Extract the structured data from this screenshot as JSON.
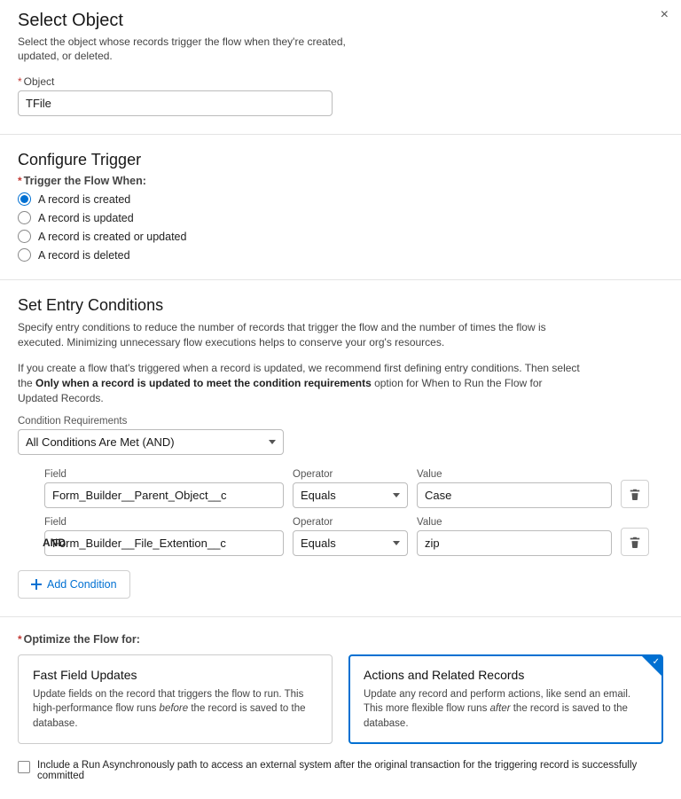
{
  "close_label": "×",
  "select_object": {
    "title": "Select Object",
    "desc": "Select the object whose records trigger the flow when they're created, updated, or deleted.",
    "object_label": "Object",
    "object_value": "TFile"
  },
  "configure_trigger": {
    "title": "Configure Trigger",
    "when_label": "Trigger the Flow When:",
    "options": {
      "created": "A record is created",
      "updated": "A record is updated",
      "created_or_updated": "A record is created or updated",
      "deleted": "A record is deleted"
    }
  },
  "entry_conditions": {
    "title": "Set Entry Conditions",
    "desc1": "Specify entry conditions to reduce the number of records that trigger the flow and the number of times the flow is executed. Minimizing unnecessary flow executions helps to conserve your org's resources.",
    "desc2_a": "If you create a flow that's triggered when a record is updated, we recommend first defining entry conditions. Then select the ",
    "desc2_bold": "Only when a record is updated to meet the condition requirements",
    "desc2_b": " option for When to Run the Flow for Updated Records.",
    "req_label": "Condition Requirements",
    "req_value": "All Conditions Are Met (AND)",
    "field_label": "Field",
    "operator_label": "Operator",
    "value_label": "Value",
    "and_label": "AND",
    "rows": [
      {
        "field": "Form_Builder__Parent_Object__c",
        "operator": "Equals",
        "value": "Case"
      },
      {
        "field": "Form_Builder__File_Extention__c",
        "operator": "Equals",
        "value": "zip"
      }
    ],
    "add_condition": "Add Condition"
  },
  "optimize": {
    "label": "Optimize the Flow for:",
    "card1_title": "Fast Field Updates",
    "card1_p1": "Update fields on the record that triggers the flow to run. This high-performance flow runs ",
    "card1_it": "before",
    "card1_p2": " the record is saved to the database.",
    "card2_title": "Actions and Related Records",
    "card2_p1": "Update any record and perform actions, like send an email. This more flexible flow runs ",
    "card2_it": "after",
    "card2_p2": " the record is saved to the database."
  },
  "async_checkbox": "Include a Run Asynchronously path to access an external system after the original transaction for the triggering record is successfully committed"
}
